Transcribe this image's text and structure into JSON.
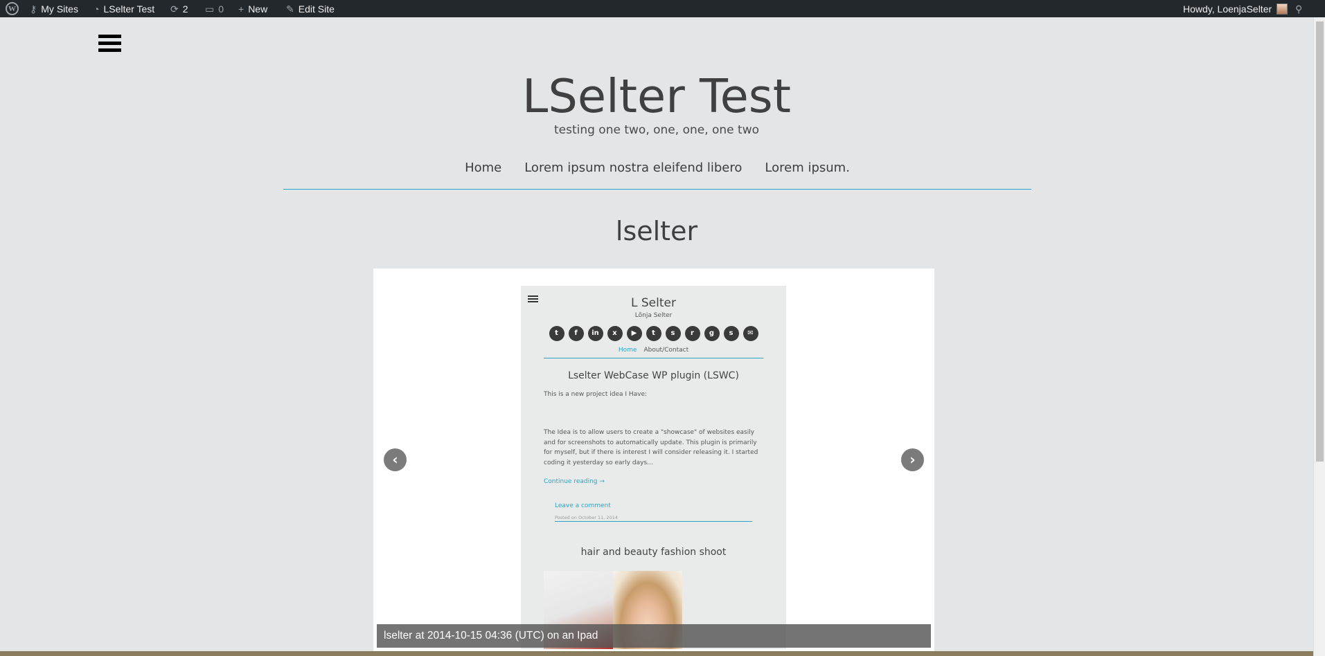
{
  "adminbar": {
    "my_sites": "My Sites",
    "site_name": "LSelter Test",
    "updates_count": "2",
    "comments_count": "0",
    "new_label": "New",
    "edit_site": "Edit Site",
    "howdy": "Howdy, LoenjaSelter"
  },
  "header": {
    "site_title": "LSelter Test",
    "tagline": "testing one two, one, one, one two"
  },
  "nav": {
    "items": [
      {
        "label": "Home"
      },
      {
        "label": "Lorem ipsum nostra eleifend libero"
      },
      {
        "label": "Lorem ipsum."
      }
    ]
  },
  "page": {
    "title": "lselter"
  },
  "slider": {
    "prev": "‹",
    "next": "›",
    "caption": "lselter at 2014-10-15 04:36 (UTC) on an Ipad"
  },
  "screenshot": {
    "title": "L Selter",
    "tagline": "Lõnja Selter",
    "social_icons": [
      "twitter-icon",
      "facebook-icon",
      "linkedin-icon",
      "xing-icon",
      "youtube-icon",
      "tumblr-icon",
      "stumbleupon-icon",
      "reddit-icon",
      "github-icon",
      "steam-icon",
      "email-icon"
    ],
    "social_glyphs": [
      "t",
      "f",
      "in",
      "x",
      "▶",
      "t",
      "s",
      "r",
      "g",
      "s",
      "✉"
    ],
    "nav": [
      "Home",
      "About/Contact"
    ],
    "post1": {
      "title": "Lselter WebCase WP plugin (LSWC)",
      "intro": "This is a new project idea I Have:",
      "body": "The Idea is to allow users to create a \"showcase\" of websites easily and for screenshots to automatically update. This plugin is primarily for myself, but if there is interest I will consider releasing it.  I started coding it yesterday so early days…",
      "more": "Continue reading →",
      "comment": "Leave a comment",
      "posted": "Posted on October 11, 2014"
    },
    "post2": {
      "title": "hair and beauty fashion shoot"
    }
  }
}
